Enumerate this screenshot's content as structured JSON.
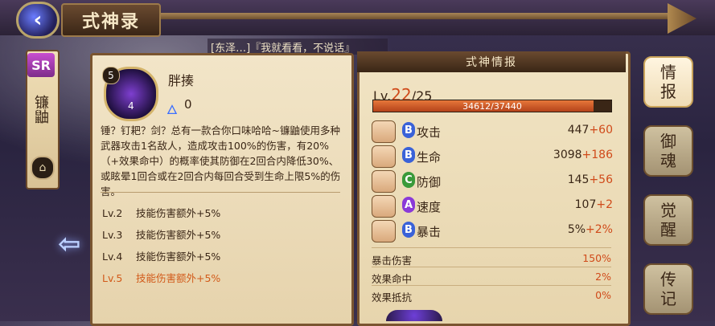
{
  "header": {
    "back_icon": "back-orb-icon",
    "title": "式神录"
  },
  "left_strip": {
    "rarity": "SR",
    "name": "镰鼬",
    "lock_glyph": "⌂"
  },
  "quote": "[东泽…]『我就看看，不说话』",
  "skill": {
    "cost": "5",
    "level_badge": "4",
    "name": "胖揍",
    "fire_value": "0",
    "description": "锤？钉耙？剑？总有一款合你口味哈哈~镰鼬使用多种武器攻击1名敌人，造成攻击100%的伤害，有20%（+效果命中）的概率使其防御在2回合内降低30%、或眩晕1回合或在2回合内每回合受到生命上限5%的伤害。",
    "levels": [
      {
        "lv": "Lv.2",
        "text": "技能伤害额外+5%"
      },
      {
        "lv": "Lv.3",
        "text": "技能伤害额外+5%"
      },
      {
        "lv": "Lv.4",
        "text": "技能伤害额外+5%"
      },
      {
        "lv": "Lv.5",
        "text": "技能伤害额外+5%"
      }
    ]
  },
  "info": {
    "title": "式神情报",
    "lv_prefix": "Lv.",
    "lv_current": "22",
    "lv_max": "/25",
    "xp_text": "34612/37440",
    "xp_fraction": 0.924,
    "stats": [
      {
        "icon": "fan-icon",
        "grade": "B",
        "grade_color": "#3a62d8",
        "name": "攻击",
        "base": "447",
        "bonus": "+60"
      },
      {
        "icon": "scroll-icon",
        "grade": "B",
        "grade_color": "#3a62d8",
        "name": "生命",
        "base": "3098",
        "bonus": "+186"
      },
      {
        "icon": "armor-icon",
        "grade": "C",
        "grade_color": "#3a9a3a",
        "name": "防御",
        "base": "145",
        "bonus": "+56"
      },
      {
        "icon": "wing-icon",
        "grade": "A",
        "grade_color": "#8a3ad8",
        "name": "速度",
        "base": "107",
        "bonus": "+2"
      },
      {
        "icon": "crit-icon",
        "grade": "B",
        "grade_color": "#3a62d8",
        "name": "暴击",
        "base": "5%",
        "bonus": "+2%"
      }
    ],
    "sub_stats": [
      {
        "name": "暴击伤害",
        "value": "150%"
      },
      {
        "name": "效果命中",
        "value": "2%"
      },
      {
        "name": "效果抵抗",
        "value": "0%"
      }
    ]
  },
  "tabs": [
    {
      "label": "情\n报",
      "active": true
    },
    {
      "label": "御\n魂",
      "active": false
    },
    {
      "label": "觉\n醒",
      "active": false
    },
    {
      "label": "传\n记",
      "active": false
    }
  ]
}
